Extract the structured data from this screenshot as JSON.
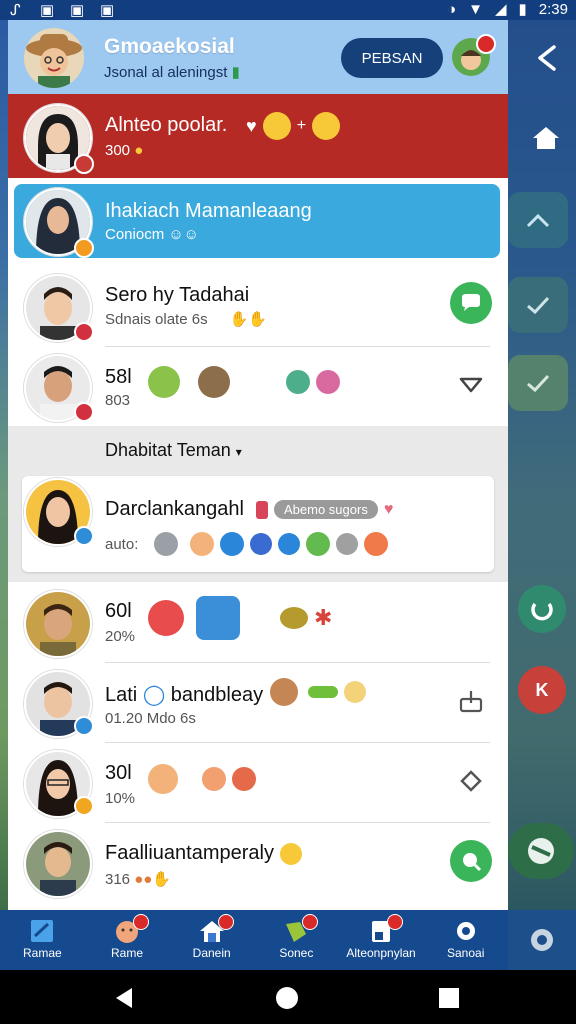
{
  "status_bar": {
    "time": "2:39"
  },
  "header": {
    "title": "Gmoaekosial",
    "subtitle": "Jsonal al aleningst",
    "button_label": "PEBSAN"
  },
  "chats": [
    {
      "name": "Alnteo poolar.",
      "sub": "300",
      "highlight": "red"
    },
    {
      "name": "Ihakiach Mamanleaang",
      "sub": "Coniocm",
      "highlight": "blue"
    },
    {
      "name": "Sero hy Tadahai",
      "sub": "Sdnais olate 6s",
      "action": "chat"
    },
    {
      "name": "58l",
      "sub": "803",
      "action": "chevron"
    }
  ],
  "section_header": "Dhabitat Teman",
  "featured": {
    "name": "Darclankangahl",
    "tag": "Abemo sugors",
    "sub": "auto:"
  },
  "friends": [
    {
      "name": "60l",
      "sub": "20%"
    },
    {
      "name": "Lati",
      "name_suffix": "bandbleay",
      "sub": "01.20 Mdo 6s",
      "action": "share"
    },
    {
      "name": "30l",
      "sub": "10%",
      "action": "diamond"
    },
    {
      "name": "Faalliuantamperaly",
      "sub": "316",
      "action": "search"
    }
  ],
  "bottom_nav": [
    {
      "label": "Ramae",
      "icon": "flag-icon"
    },
    {
      "label": "Rame",
      "icon": "face-icon"
    },
    {
      "label": "Danein",
      "icon": "home-icon"
    },
    {
      "label": "Sonec",
      "icon": "tag-icon"
    },
    {
      "label": "Alteonpnylan",
      "icon": "note-icon"
    },
    {
      "label": "Sanoai",
      "icon": "gear-icon"
    }
  ],
  "colors": {
    "header_bg": "#9dc8f0",
    "red_row": "#b52a25",
    "blue_row": "#3aa9dd",
    "nav_bg": "#164a8e",
    "accent_green": "#3bb55a"
  }
}
